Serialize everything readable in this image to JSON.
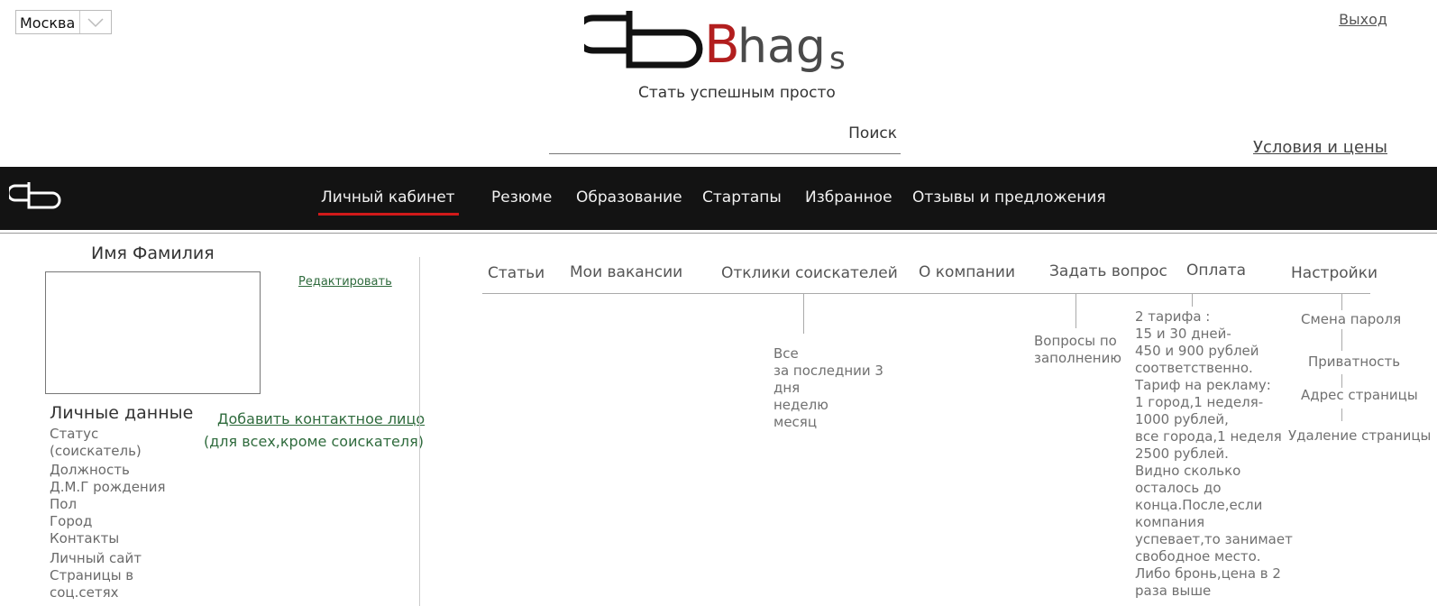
{
  "header": {
    "city": "Москва",
    "logout": "Выход",
    "logo_b": "B",
    "logo_hag": "hag",
    "logo_s": "s",
    "tagline": "Стать успешным просто",
    "search_label": "Поиск",
    "terms_link": "Условия и цены"
  },
  "nav": {
    "items": [
      "Личный кабинет",
      "Резюме",
      "Образование",
      "Стартапы",
      "Избранное",
      "Отзывы и предложения"
    ]
  },
  "profile": {
    "name": "Имя Фамилия",
    "edit": "Редактировать",
    "personal_title": "Личные данные",
    "add_contact": "Добавить контактное лицо",
    "add_contact_note": "(для всех,кроме  соискателя)",
    "fields": [
      "Статус",
      "(соискатель)",
      "Должность",
      "Д.М.Г рождения",
      "Пол",
      "Город",
      "Контакты",
      "Личный сайт",
      "Страницы в",
      "соц.сетях"
    ]
  },
  "tabs": [
    "Статьи",
    "Мои вакансии",
    "Отклики соискателей",
    "О компании",
    "Задать вопрос",
    "Оплата",
    "Настройки"
  ],
  "responses_sub": [
    "Все",
    "за последнии 3",
    "дня",
    "неделю",
    "месяц"
  ],
  "question_sub": [
    "Вопросы по",
    "заполнению"
  ],
  "payment_sub": [
    "2 тарифа :",
    "15 и 30 дней-",
    "450 и 900 рублей",
    "соответственно.",
    "Тариф на рекламу:",
    "1 город,1 неделя-",
    "1000 рублей,",
    "все города,1 неделя",
    "2500 рублей.",
    "Видно сколько",
    "осталось до",
    "конца.После,если",
    "компания",
    "успевает,то занимает",
    "свободное место.",
    "Либо бронь,цена в 2",
    "раза выше"
  ],
  "settings_sub": [
    "Смена пароля",
    "Приватность",
    "Адрес страницы",
    "Удаление страницы"
  ]
}
